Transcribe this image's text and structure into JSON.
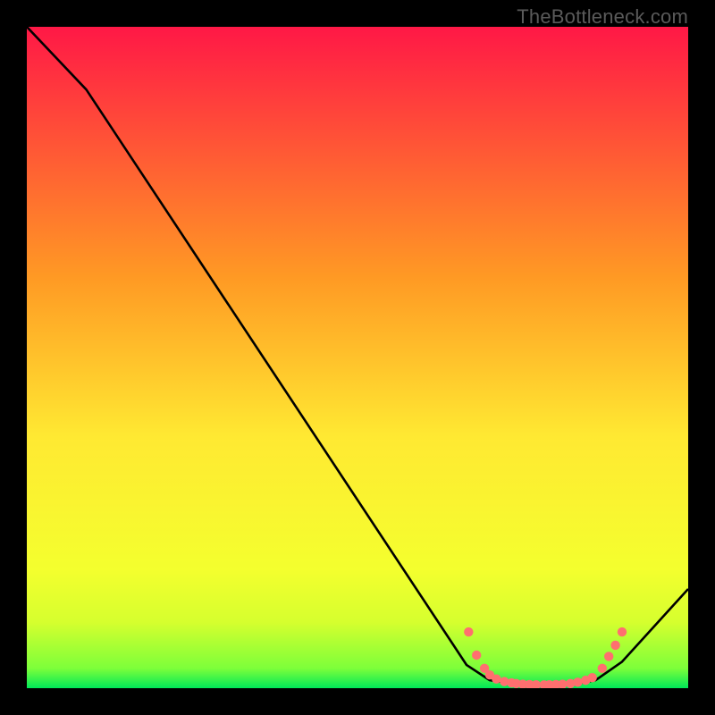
{
  "watermark": "TheBottleneck.com",
  "chart_data": {
    "type": "line",
    "xlabel": "",
    "ylabel": "",
    "xlim": [
      0,
      100
    ],
    "ylim": [
      0,
      100
    ],
    "background_gradient": {
      "top": "#ff1846",
      "mid_upper": "#ff9a24",
      "mid": "#ffe932",
      "mid_lower": "#d6ff2e",
      "bottom": "#00e858"
    },
    "curve": [
      {
        "x": 0,
        "y": 100
      },
      {
        "x": 9,
        "y": 90.5
      },
      {
        "x": 66.5,
        "y": 3.5
      },
      {
        "x": 70,
        "y": 1.2
      },
      {
        "x": 75,
        "y": 0.5
      },
      {
        "x": 82,
        "y": 0.5
      },
      {
        "x": 86,
        "y": 1.2
      },
      {
        "x": 90,
        "y": 4
      },
      {
        "x": 100,
        "y": 15
      }
    ],
    "dots": [
      {
        "x": 66.8,
        "y": 8.5
      },
      {
        "x": 68.0,
        "y": 5.0
      },
      {
        "x": 69.2,
        "y": 3.0
      },
      {
        "x": 70.0,
        "y": 2.0
      },
      {
        "x": 71.0,
        "y": 1.4
      },
      {
        "x": 72.2,
        "y": 1.0
      },
      {
        "x": 73.3,
        "y": 0.8
      },
      {
        "x": 74.0,
        "y": 0.7
      },
      {
        "x": 75.0,
        "y": 0.6
      },
      {
        "x": 76.0,
        "y": 0.55
      },
      {
        "x": 77.0,
        "y": 0.52
      },
      {
        "x": 78.2,
        "y": 0.5
      },
      {
        "x": 79.0,
        "y": 0.52
      },
      {
        "x": 80.0,
        "y": 0.55
      },
      {
        "x": 81.0,
        "y": 0.6
      },
      {
        "x": 82.2,
        "y": 0.7
      },
      {
        "x": 83.3,
        "y": 0.9
      },
      {
        "x": 84.5,
        "y": 1.2
      },
      {
        "x": 85.5,
        "y": 1.6
      },
      {
        "x": 87.0,
        "y": 3.0
      },
      {
        "x": 88.0,
        "y": 4.8
      },
      {
        "x": 89.0,
        "y": 6.5
      },
      {
        "x": 90.0,
        "y": 8.5
      }
    ],
    "dot_color": "#ff6f6f",
    "curve_color": "#000000"
  }
}
